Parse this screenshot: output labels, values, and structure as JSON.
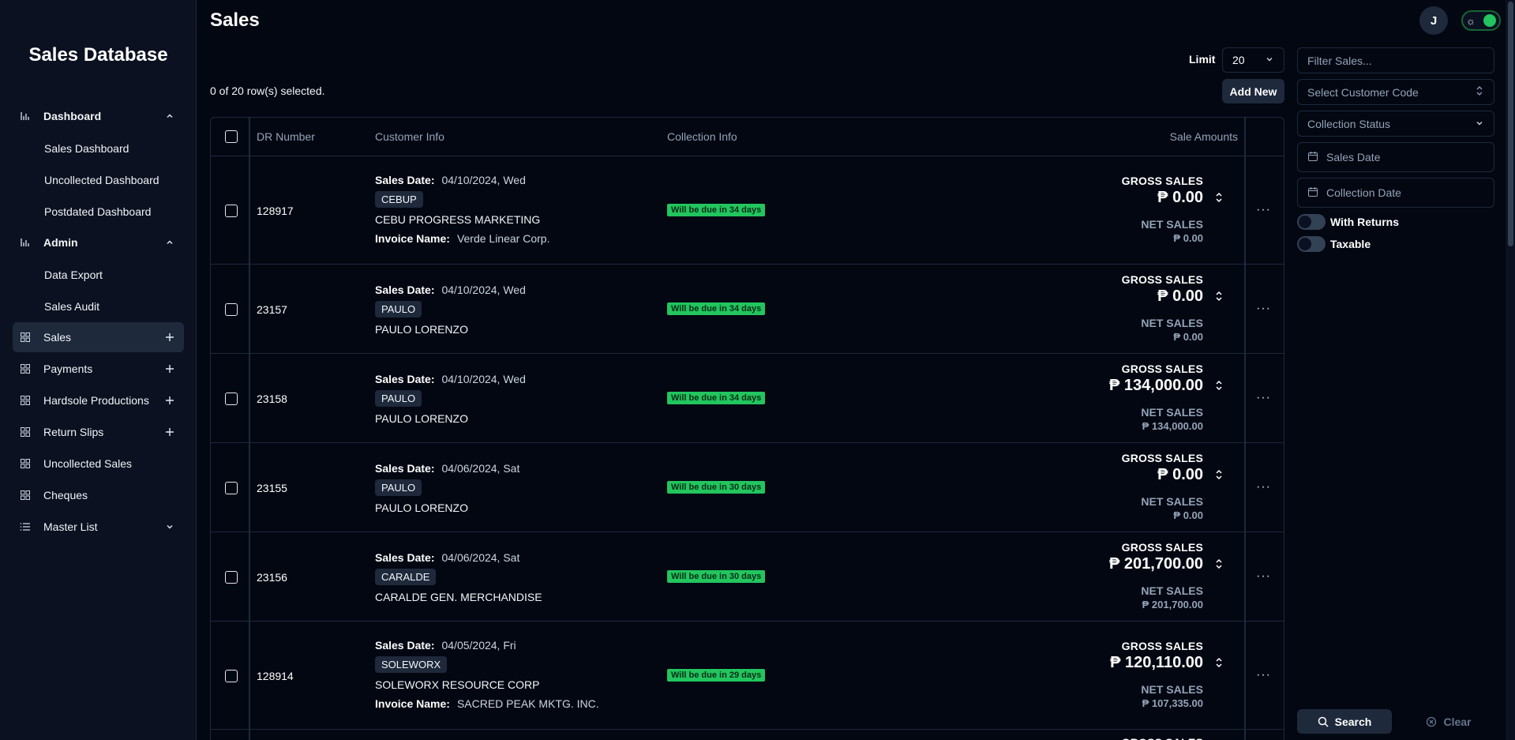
{
  "sidebar": {
    "title": "Sales Database",
    "nav": [
      {
        "label": "Dashboard",
        "icon": "bar-chart-icon",
        "action": "chevron-up",
        "bold": true,
        "children": [
          "Sales Dashboard",
          "Uncollected Dashboard",
          "Postdated Dashboard"
        ]
      },
      {
        "label": "Admin",
        "icon": "bar-chart-icon",
        "action": "chevron-up",
        "bold": true,
        "children": [
          "Data Export",
          "Sales Audit"
        ]
      },
      {
        "label": "Sales",
        "icon": "grid-icon",
        "action": "plus",
        "active": true
      },
      {
        "label": "Payments",
        "icon": "grid-icon",
        "action": "plus"
      },
      {
        "label": "Hardsole Productions",
        "icon": "grid-icon",
        "action": "plus"
      },
      {
        "label": "Return Slips",
        "icon": "grid-icon",
        "action": "plus"
      },
      {
        "label": "Uncollected Sales",
        "icon": "grid-icon"
      },
      {
        "label": "Cheques",
        "icon": "grid-icon"
      },
      {
        "label": "Master List",
        "icon": "list-icon",
        "action": "chevron-down"
      }
    ]
  },
  "header": {
    "title": "Sales",
    "avatar_initial": "J"
  },
  "toolbar": {
    "limit_label": "Limit",
    "limit_value": "20",
    "selected_text": "0 of 20 row(s) selected.",
    "add_new_label": "Add New"
  },
  "table": {
    "columns": [
      "DR Number",
      "Customer Info",
      "Collection Info",
      "Sale Amounts"
    ],
    "sales_date_label": "Sales Date:",
    "invoice_label": "Invoice Name:",
    "gross_label": "GROSS SALES",
    "net_label": "NET SALES",
    "rows": [
      {
        "dr": "128917",
        "date": "04/10/2024, Wed",
        "code": "CEBUP",
        "customer": "CEBU PROGRESS MARKETING",
        "invoice": "Verde Linear Corp.",
        "due": "Will be due in 34 days",
        "gross": "₱ 0.00",
        "net": "₱ 0.00"
      },
      {
        "dr": "23157",
        "date": "04/10/2024, Wed",
        "code": "PAULO",
        "customer": "PAULO LORENZO",
        "invoice": "",
        "due": "Will be due in 34 days",
        "gross": "₱ 0.00",
        "net": "₱ 0.00"
      },
      {
        "dr": "23158",
        "date": "04/10/2024, Wed",
        "code": "PAULO",
        "customer": "PAULO LORENZO",
        "invoice": "",
        "due": "Will be due in 34 days",
        "gross": "₱ 134,000.00",
        "net": "₱ 134,000.00"
      },
      {
        "dr": "23155",
        "date": "04/06/2024, Sat",
        "code": "PAULO",
        "customer": "PAULO LORENZO",
        "invoice": "",
        "due": "Will be due in 30 days",
        "gross": "₱ 0.00",
        "net": "₱ 0.00"
      },
      {
        "dr": "23156",
        "date": "04/06/2024, Sat",
        "code": "CARALDE",
        "customer": "CARALDE GEN. MERCHANDISE",
        "invoice": "",
        "due": "Will be due in 30 days",
        "gross": "₱ 201,700.00",
        "net": "₱ 201,700.00"
      },
      {
        "dr": "128914",
        "date": "04/05/2024, Fri",
        "code": "SOLEWORX",
        "customer": "SOLEWORX RESOURCE CORP",
        "invoice": "SACRED PEAK MKTG. INC.",
        "due": "Will be due in 29 days",
        "gross": "₱ 120,110.00",
        "net": "₱ 107,335.00"
      },
      {
        "dr": "",
        "date": "",
        "code": "",
        "customer": "",
        "invoice": "",
        "due": "",
        "gross": "",
        "net": "",
        "partial_gross_label": "GROSS SALES"
      }
    ]
  },
  "filters": {
    "search_placeholder": "Filter Sales...",
    "customer_code_placeholder": "Select Customer Code",
    "collection_status_placeholder": "Collection Status",
    "sales_date_placeholder": "Sales Date",
    "collection_date_placeholder": "Collection Date",
    "with_returns_label": "With Returns",
    "taxable_label": "Taxable",
    "search_label": "Search",
    "clear_label": "Clear"
  },
  "colors": {
    "background": "#030712",
    "sidebar": "#0b1120",
    "border": "#1e293b",
    "due_badge": "#22c55e",
    "toggle_on": "#22c55e"
  }
}
